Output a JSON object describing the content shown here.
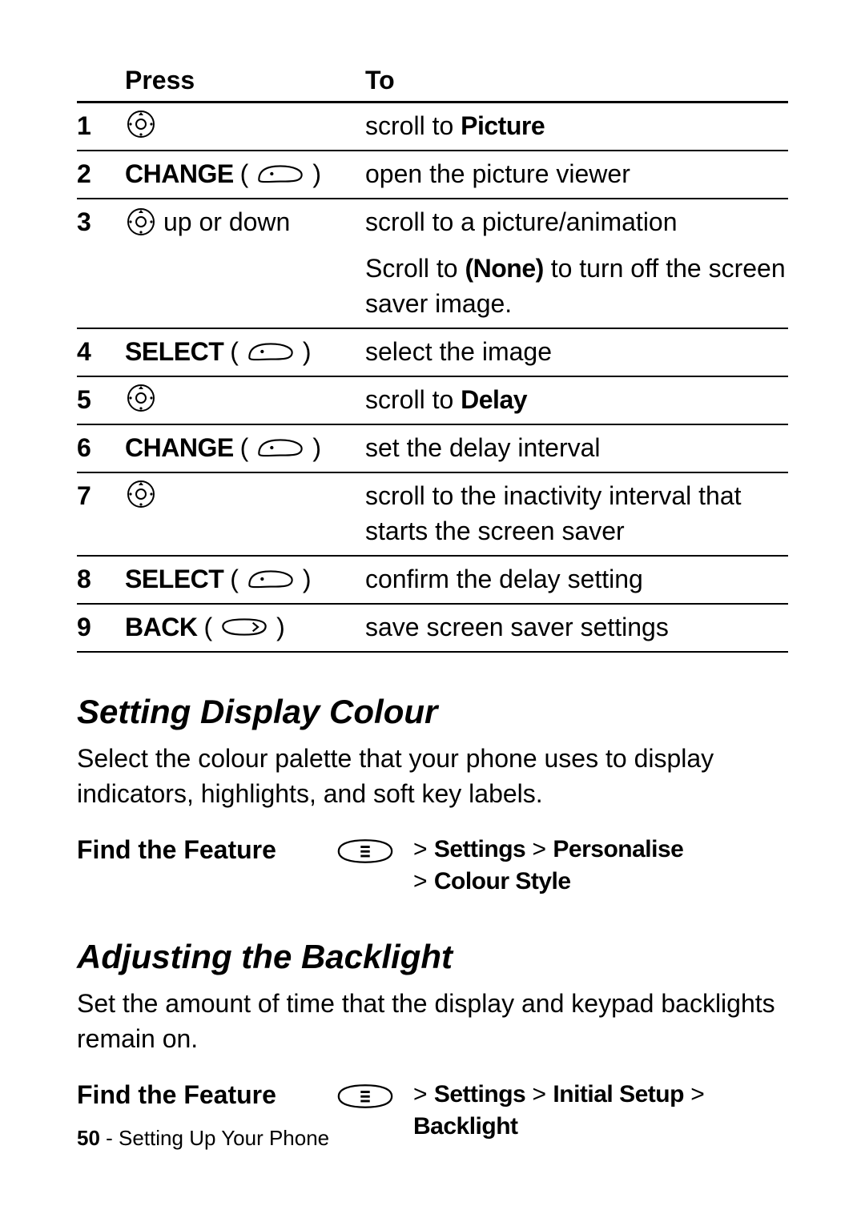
{
  "table": {
    "headers": {
      "press": "Press",
      "to": "To"
    },
    "rows": [
      {
        "num": "1",
        "press": {
          "key": "",
          "icon": "nav",
          "suffix": ""
        },
        "to_parts": [
          {
            "t": "scroll to ",
            "lcd": false
          },
          {
            "t": "Picture",
            "lcd": true
          }
        ]
      },
      {
        "num": "2",
        "press": {
          "key": "CHANGE",
          "icon": "softkey",
          "suffix": ""
        },
        "to_parts": [
          {
            "t": "open the picture viewer",
            "lcd": false
          }
        ]
      },
      {
        "num": "3",
        "press": {
          "key": "",
          "icon": "nav",
          "suffix": "up or down"
        },
        "to_parts": [
          {
            "t": "scroll to a picture/animation",
            "lcd": false
          }
        ],
        "extra_parts": [
          {
            "t": "Scroll to ",
            "lcd": false
          },
          {
            "t": "(None)",
            "lcd": true
          },
          {
            "t": " to turn off the screen saver image.",
            "lcd": false
          }
        ]
      },
      {
        "num": "4",
        "press": {
          "key": "SELECT",
          "icon": "softkey",
          "suffix": ""
        },
        "to_parts": [
          {
            "t": "select the image",
            "lcd": false
          }
        ]
      },
      {
        "num": "5",
        "press": {
          "key": "",
          "icon": "nav",
          "suffix": ""
        },
        "to_parts": [
          {
            "t": "scroll to ",
            "lcd": false
          },
          {
            "t": "Delay",
            "lcd": true
          }
        ]
      },
      {
        "num": "6",
        "press": {
          "key": "CHANGE",
          "icon": "softkey",
          "suffix": ""
        },
        "to_parts": [
          {
            "t": "set the delay interval",
            "lcd": false
          }
        ]
      },
      {
        "num": "7",
        "press": {
          "key": "",
          "icon": "nav",
          "suffix": ""
        },
        "to_parts": [
          {
            "t": "scroll to the inactivity interval that starts the screen saver",
            "lcd": false
          }
        ]
      },
      {
        "num": "8",
        "press": {
          "key": "SELECT",
          "icon": "softkey",
          "suffix": ""
        },
        "to_parts": [
          {
            "t": "confirm the delay setting",
            "lcd": false
          }
        ]
      },
      {
        "num": "9",
        "press": {
          "key": "BACK",
          "icon": "softkey-alt",
          "suffix": ""
        },
        "to_parts": [
          {
            "t": "save screen saver settings",
            "lcd": false
          }
        ]
      }
    ]
  },
  "section1": {
    "title": "Setting Display Colour",
    "body": "Select the colour palette that your phone uses to display indicators, highlights, and soft key labels.",
    "find_label": "Find the Feature",
    "path_parts": [
      {
        "t": "> ",
        "lcd": false
      },
      {
        "t": "Settings",
        "lcd": true
      },
      {
        "t": " > ",
        "lcd": false
      },
      {
        "t": "Personalise",
        "lcd": true
      },
      {
        "t": "\n",
        "lcd": false
      },
      {
        "t": "> ",
        "lcd": false
      },
      {
        "t": "Colour Style",
        "lcd": true
      }
    ]
  },
  "section2": {
    "title": "Adjusting the Backlight",
    "body": "Set the amount of time that the display and keypad backlights remain on.",
    "find_label": "Find the Feature",
    "path_parts": [
      {
        "t": "> ",
        "lcd": false
      },
      {
        "t": "Settings",
        "lcd": true
      },
      {
        "t": " > ",
        "lcd": false
      },
      {
        "t": "Initial Setup",
        "lcd": true
      },
      {
        "t": " > ",
        "lcd": false
      },
      {
        "t": "Backlight",
        "lcd": true
      }
    ]
  },
  "footer": {
    "page_number": "50",
    "sep": " - ",
    "section": "Setting Up Your Phone"
  }
}
